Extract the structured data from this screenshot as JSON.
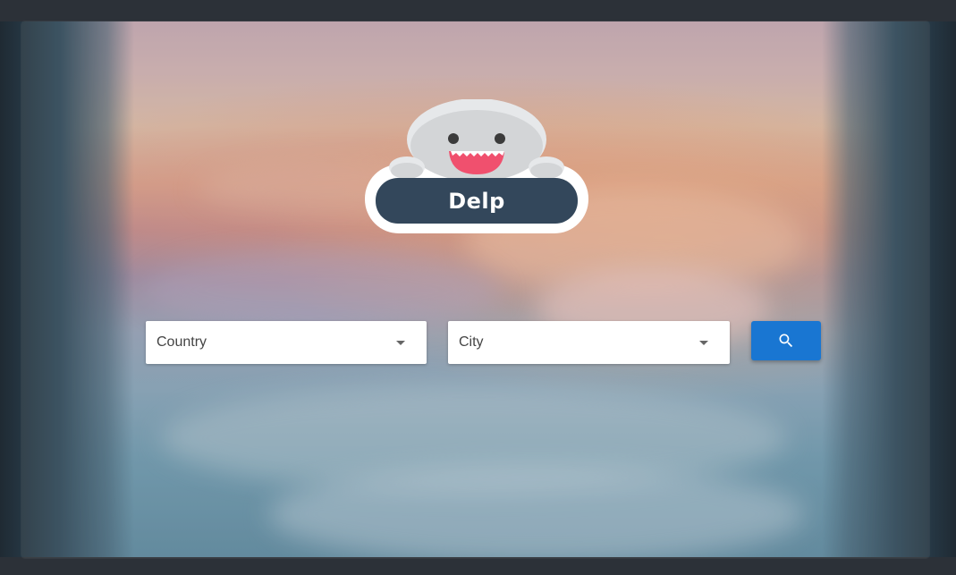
{
  "logo": {
    "text": "Delp",
    "icon": "delp-mascot-icon"
  },
  "search": {
    "country": {
      "placeholder": "Country",
      "icon": "dropdown-arrow-icon"
    },
    "city": {
      "placeholder": "City",
      "icon": "dropdown-arrow-icon"
    },
    "button": {
      "icon": "search-icon"
    }
  },
  "colors": {
    "accent": "#1976d2",
    "logo_banner": "#33475b",
    "mascot_body": "#d8dadc",
    "mascot_mouth": "#f0506e"
  }
}
